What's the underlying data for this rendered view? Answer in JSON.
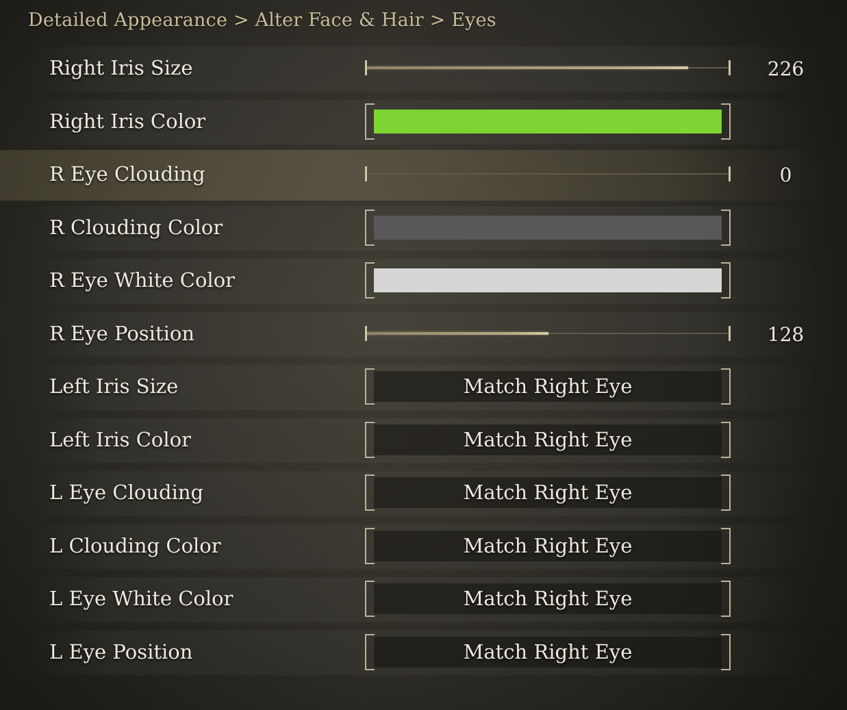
{
  "breadcrumb": "Detailed Appearance > Alter Face & Hair > Eyes",
  "rows": [
    {
      "label": "Right Iris Size",
      "type": "slider",
      "value": "226",
      "fill_fraction": 0.886
    },
    {
      "label": "Right Iris Color",
      "type": "color",
      "color": "#7ed432"
    },
    {
      "label": "R Eye Clouding",
      "type": "slider",
      "value": "0",
      "fill_fraction": 0.0,
      "selected": true
    },
    {
      "label": "R Clouding Color",
      "type": "color",
      "color": "#58585a"
    },
    {
      "label": "R Eye White Color",
      "type": "color",
      "color": "#d6d6d6"
    },
    {
      "label": "R Eye Position",
      "type": "slider",
      "value": "128",
      "fill_fraction": 0.502
    },
    {
      "label": "Left Iris Size",
      "type": "button",
      "text": "Match Right Eye"
    },
    {
      "label": "Left Iris Color",
      "type": "button",
      "text": "Match Right Eye"
    },
    {
      "label": "L Eye Clouding",
      "type": "button",
      "text": "Match Right Eye"
    },
    {
      "label": "L Clouding Color",
      "type": "button",
      "text": "Match Right Eye"
    },
    {
      "label": "L Eye White Color",
      "type": "button",
      "text": "Match Right Eye"
    },
    {
      "label": "L Eye Position",
      "type": "button",
      "text": "Match Right Eye"
    }
  ]
}
